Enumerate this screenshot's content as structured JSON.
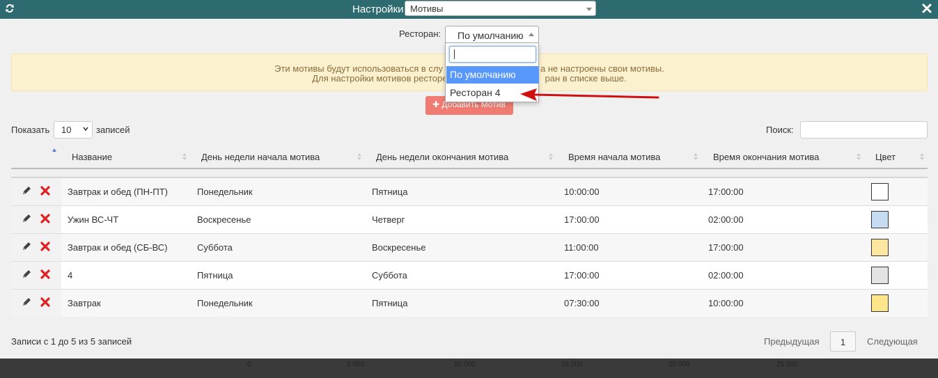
{
  "header": {
    "title": "Настройки",
    "select_value": "Мотивы",
    "refresh_icon": "refresh-icon",
    "close_icon": "close-icon"
  },
  "restaurant": {
    "label": "Ресторан:",
    "selected": "По умолчанию",
    "dropdown": {
      "search_value": "",
      "options": [
        "По умолчанию",
        "Ресторан 4"
      ],
      "highlighted": "По умолчанию"
    }
  },
  "alert": {
    "line1_left": "Эти мотивы будут использоваться в слу",
    "line1_right": "а не настроены свои мотивы.",
    "line2_left": "Для настройки мотивов ресторе",
    "line2_right": "ран в списке выше."
  },
  "add_button": {
    "label": "Добавить Мотив"
  },
  "length": {
    "show_label": "Показать",
    "value": "10",
    "records_label": "записей"
  },
  "search": {
    "label": "Поиск:",
    "value": ""
  },
  "table": {
    "headers": [
      "Название",
      "День недели начала мотива",
      "День недели окончания мотива",
      "Время начала мотива",
      "Время окончания мотива",
      "Цвет"
    ],
    "rows": [
      {
        "name": "Завтрак и обед (ПН-ПТ)",
        "start_day": "Понедельник",
        "end_day": "Пятница",
        "start_time": "10:00:00",
        "end_time": "17:00:00",
        "color": "#ffffff"
      },
      {
        "name": "Ужин ВС-ЧТ",
        "start_day": "Воскресенье",
        "end_day": "Четверг",
        "start_time": "17:00:00",
        "end_time": "02:00:00",
        "color": "#c6dcf2"
      },
      {
        "name": "Завтрак и обед (СБ-ВС)",
        "start_day": "Суббота",
        "end_day": "Воскресенье",
        "start_time": "11:00:00",
        "end_time": "17:00:00",
        "color": "#fde6a0"
      },
      {
        "name": "4",
        "start_day": "Пятница",
        "end_day": "Суббота",
        "start_time": "17:00:00",
        "end_time": "02:00:00",
        "color": "#e3e3e3"
      },
      {
        "name": "Завтрак",
        "start_day": "Понедельник",
        "end_day": "Пятница",
        "start_time": "07:30:00",
        "end_time": "10:00:00",
        "color": "#fde68a"
      }
    ]
  },
  "footer": {
    "info": "Записи с 1 до 5 из 5 записей",
    "prev": "Предыдущая",
    "page": "1",
    "next": "Следующая"
  },
  "background_axis": [
    "0",
    "5 000",
    "10 000",
    "15 000",
    "20 000",
    "25 000"
  ],
  "colors": {
    "header_bg": "#2d6b70",
    "add_button": "#ef7b72",
    "alert_bg": "#fcf1cf",
    "highlight": "#5897fb",
    "arrow": "#d01010",
    "delete": "#e02020"
  }
}
